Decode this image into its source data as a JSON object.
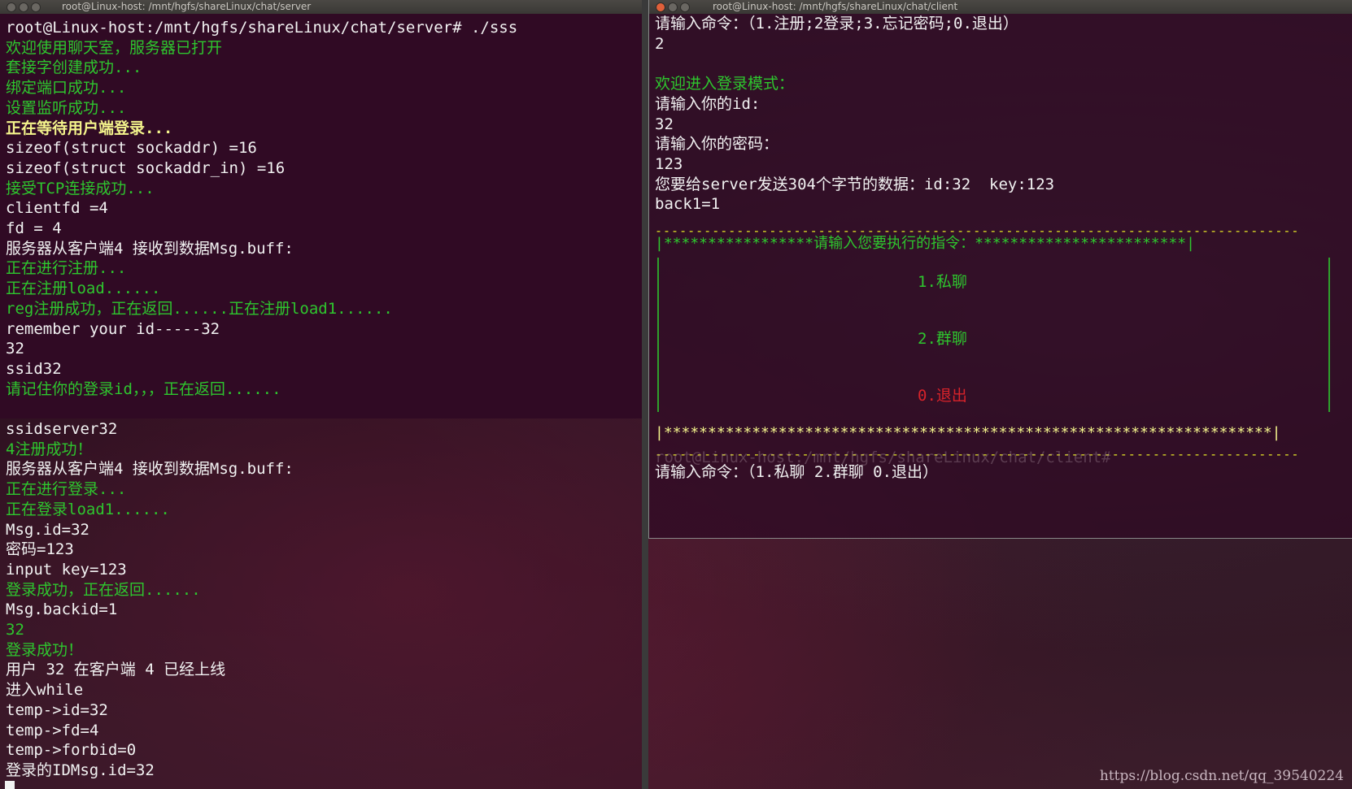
{
  "server_window": {
    "title": "root@Linux-host: /mnt/hgfs/shareLinux/chat/server",
    "lines": [
      {
        "text": "root@Linux-host:/mnt/hgfs/shareLinux/chat/server# ./sss",
        "color": "w"
      },
      {
        "text": "欢迎使用聊天室，服务器已打开",
        "color": "g"
      },
      {
        "text": "套接字创建成功...",
        "color": "g"
      },
      {
        "text": "绑定端口成功...",
        "color": "g"
      },
      {
        "text": "设置监听成功...",
        "color": "g"
      },
      {
        "text": "正在等待用户端登录...",
        "color": "y"
      },
      {
        "text": "sizeof(struct sockaddr) =16",
        "color": "w"
      },
      {
        "text": "sizeof(struct sockaddr_in) =16",
        "color": "w"
      },
      {
        "text": "接受TCP连接成功...",
        "color": "g"
      },
      {
        "text": "clientfd =4",
        "color": "w"
      },
      {
        "text": "fd = 4",
        "color": "w"
      },
      {
        "text": "服务器从客户端4 接收到数据Msg.buff:",
        "color": "w"
      },
      {
        "text": "正在进行注册...",
        "color": "g"
      },
      {
        "text": "正在注册load......",
        "color": "g"
      },
      {
        "text": "reg注册成功，正在返回......正在注册load1......",
        "color": "g"
      },
      {
        "text": "remember your id-----32",
        "color": "w"
      },
      {
        "text": "32",
        "color": "w"
      },
      {
        "text": "ssid32",
        "color": "w"
      },
      {
        "text": "请记住你的登录id，，，正在返回......",
        "color": "g"
      },
      {
        "text": "",
        "color": "w"
      },
      {
        "text": "ssidserver32",
        "color": "w"
      },
      {
        "text": "4注册成功！",
        "color": "g"
      },
      {
        "text": "服务器从客户端4 接收到数据Msg.buff:",
        "color": "w"
      },
      {
        "text": "正在进行登录...",
        "color": "g"
      },
      {
        "text": "正在登录load1......",
        "color": "g"
      },
      {
        "text": "Msg.id=32",
        "color": "w"
      },
      {
        "text": "密码=123",
        "color": "w"
      },
      {
        "text": "input key=123",
        "color": "w"
      },
      {
        "text": "登录成功，正在返回......",
        "color": "g"
      },
      {
        "text": "Msg.backid=1",
        "color": "w"
      },
      {
        "text": "32",
        "color": "g"
      },
      {
        "text": "登录成功！",
        "color": "g"
      },
      {
        "text": "用户 32 在客户端 4 已经上线",
        "color": "w"
      },
      {
        "text": "进入while",
        "color": "w"
      },
      {
        "text": "temp->id=32",
        "color": "w"
      },
      {
        "text": "temp->fd=4",
        "color": "w"
      },
      {
        "text": "temp->forbid=0",
        "color": "w"
      },
      {
        "text": "登录的IDMsg.id=32",
        "color": "w"
      }
    ]
  },
  "client_window": {
    "title": "root@Linux-host: /mnt/hgfs/shareLinux/chat/client",
    "lines": [
      {
        "text": "请输入命令：（1.注册;2登录;3.忘记密码;0.退出）",
        "color": "w"
      },
      {
        "text": "2",
        "color": "w"
      },
      {
        "text": "",
        "color": "w"
      },
      {
        "text": "欢迎进入登录模式：",
        "color": "g"
      },
      {
        "text": "请输入你的id:",
        "color": "w"
      },
      {
        "text": "32",
        "color": "w"
      },
      {
        "text": "请输入你的密码：",
        "color": "w"
      },
      {
        "text": "123",
        "color": "w"
      },
      {
        "text": "您要给server发送304个字节的数据：id:32  key:123",
        "color": "w"
      },
      {
        "text": "back1=1",
        "color": "w"
      }
    ],
    "menu": {
      "dash_top": "-------------------------------------------------------------------------------",
      "header": "|*****************请输入您要执行的指令：************************|",
      "item1": "1.私聊",
      "item2": "2.群聊",
      "item0": "0.退出",
      "footer": "|*********************************************************************|",
      "dash_bottom": "-------------------------------------------------------------------------------"
    },
    "ghost_prompt": "root@Linux-host:/mnt/hgfs/shareLinux/chat/client# ",
    "prompt": "请输入命令：（1.私聊 2.群聊 0.退出）"
  },
  "watermark": "https://blog.csdn.net/qq_39540224"
}
